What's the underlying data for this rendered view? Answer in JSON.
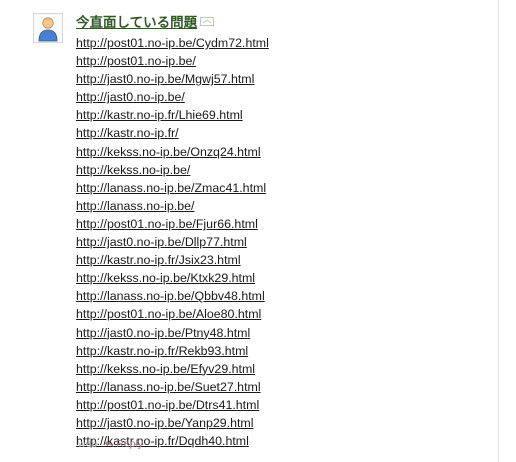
{
  "tweet": {
    "author": "今直面している問題",
    "urls": [
      "http://post01.no-ip.be/Cydm72.html",
      "http://post01.no-ip.be/",
      "http://jast0.no-ip.be/Mgwj57.html",
      "http://jast0.no-ip.be/",
      "http://kastr.no-ip.fr/Lhie69.html",
      "http://kastr.no-ip.fr/",
      "http://kekss.no-ip.be/Onzq24.html",
      "http://kekss.no-ip.be/",
      "http://lanass.no-ip.be/Zmac41.html",
      "http://lanass.no-ip.be/",
      "http://post01.no-ip.be/Fjur66.html",
      "http://jast0.no-ip.be/Dllp77.html",
      "http://kastr.no-ip.fr/Jsix23.html",
      "http://kekss.no-ip.be/Ktxk29.html",
      "http://lanass.no-ip.be/Qbbv48.html",
      "http://post01.no-ip.be/Aloe80.html",
      "http://jast0.no-ip.be/Ptny48.html",
      "http://kastr.no-ip.fr/Rekb93.html",
      "http://kekss.no-ip.be/Efyv29.html",
      "http://lanass.no-ip.be/Suet27.html",
      "http://post01.no-ip.be/Dtrs41.html",
      "http://jast0.no-ip.be/Yanp29.html",
      "http://kastr.no-ip.fr/Dqdh40.html"
    ],
    "meta_text": "web",
    "reply_label": "Reply"
  },
  "icons": {
    "avatar": "default-user-avatar-icon",
    "external": "external-link-icon",
    "reply": "reply-arrow-icon"
  },
  "colors": {
    "author": "#2f5a24",
    "link": "#1a1a1a",
    "meta": "#a9a9a9",
    "reply": "#a87a7a"
  }
}
